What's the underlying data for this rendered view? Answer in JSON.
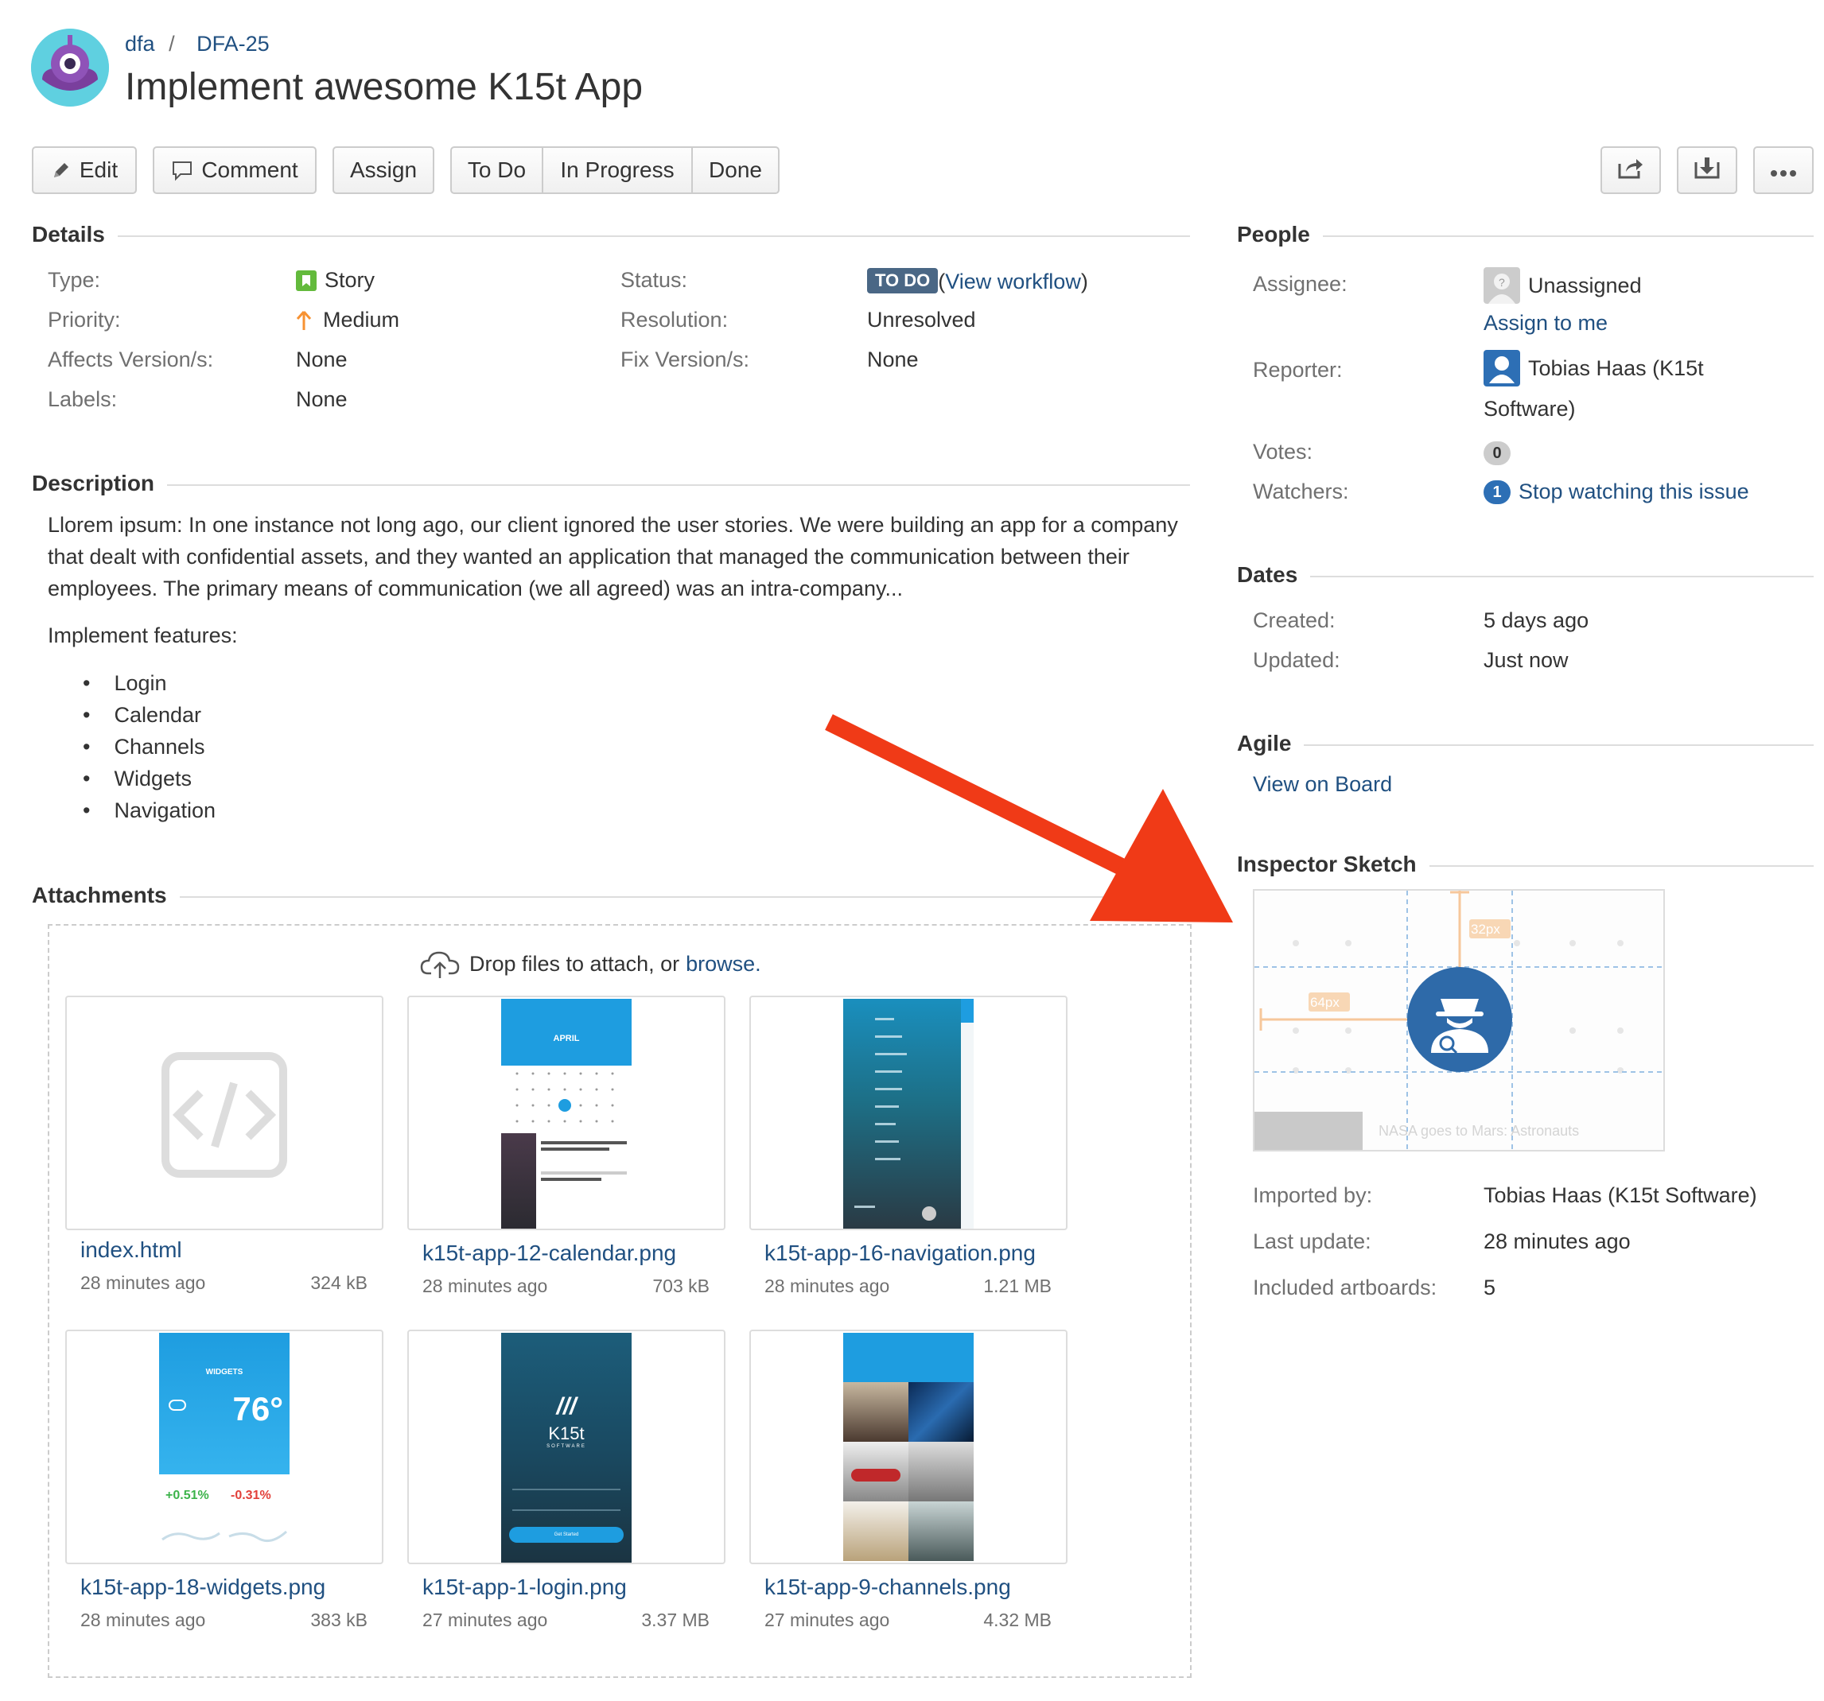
{
  "breadcrumb": {
    "project": "dfa",
    "separator": "/",
    "issue_key": "DFA-25"
  },
  "title": "Implement awesome K15t App",
  "toolbar": {
    "edit": "Edit",
    "comment": "Comment",
    "assign": "Assign",
    "todo": "To Do",
    "in_progress": "In Progress",
    "done": "Done",
    "share_icon": "share-icon",
    "export_icon": "export-icon",
    "more_icon": "more-icon"
  },
  "details": {
    "heading": "Details",
    "type_label": "Type:",
    "type_value": "Story",
    "priority_label": "Priority:",
    "priority_value": "Medium",
    "affects_label": "Affects Version/s:",
    "affects_value": "None",
    "labels_label": "Labels:",
    "labels_value": "None",
    "status_label": "Status:",
    "status_badge": "TO DO",
    "status_link": "View workflow",
    "resolution_label": "Resolution:",
    "resolution_value": "Unresolved",
    "fix_label": "Fix Version/s:",
    "fix_value": "None"
  },
  "description": {
    "heading": "Description",
    "text": "Llorem ipsum: In one instance not long ago, our client ignored the user stories. We were building an app for a company that dealt with confidential assets, and they wanted an application that managed the communication between their employees. The primary means of communication (we all agreed) was an intra-company...",
    "features_intro": "Implement features:",
    "features": [
      "Login",
      "Calendar",
      "Channels",
      "Widgets",
      "Navigation"
    ]
  },
  "attachments": {
    "heading": "Attachments",
    "drop_text": "Drop files to attach, or",
    "browse": "browse.",
    "files": [
      {
        "name": "index.html",
        "time": "28 minutes ago",
        "size": "324 kB"
      },
      {
        "name": "k15t-app-12-calendar.png",
        "time": "28 minutes ago",
        "size": "703 kB"
      },
      {
        "name": "k15t-app-16-navigation.png",
        "time": "28 minutes ago",
        "size": "1.21 MB"
      },
      {
        "name": "k15t-app-18-widgets.png",
        "time": "28 minutes ago",
        "size": "383 kB"
      },
      {
        "name": "k15t-app-1-login.png",
        "time": "27 minutes ago",
        "size": "3.37 MB"
      },
      {
        "name": "k15t-app-9-channels.png",
        "time": "27 minutes ago",
        "size": "4.32 MB"
      }
    ],
    "thumb_text": {
      "calendar_month": "APRIL",
      "widgets_title": "WIDGETS",
      "widgets_temp": "76°",
      "widgets_up": "+0.51%",
      "widgets_down": "-0.31%",
      "login_logo": "K15t",
      "login_sub": "SOFTWARE",
      "login_button": "Get Started"
    }
  },
  "people": {
    "heading": "People",
    "assignee_label": "Assignee:",
    "assignee_value": "Unassigned",
    "assign_to_me": "Assign to me",
    "reporter_label": "Reporter:",
    "reporter_value_line1": "Tobias Haas (K15t",
    "reporter_value_line2": "Software)",
    "votes_label": "Votes:",
    "votes_count": "0",
    "watchers_label": "Watchers:",
    "watchers_count": "1",
    "stop_watching": "Stop watching this issue"
  },
  "dates": {
    "heading": "Dates",
    "created_label": "Created:",
    "created_value": "5 days ago",
    "updated_label": "Updated:",
    "updated_value": "Just now"
  },
  "agile": {
    "heading": "Agile",
    "view_on_board": "View on Board"
  },
  "inspector": {
    "heading": "Inspector Sketch",
    "preview_label_1": "32px",
    "preview_label_2": "64px",
    "preview_caption": "NASA goes to Mars: Astronauts",
    "imported_label": "Imported by:",
    "imported_value": "Tobias Haas (K15t Software)",
    "last_update_label": "Last update:",
    "last_update_value": "28 minutes ago",
    "artboards_label": "Included artboards:",
    "artboards_value": "5"
  },
  "colors": {
    "link": "#205081",
    "status_todo": "#4a6785",
    "arrow": "#f03a17",
    "story": "#63ba3c",
    "priority": "#f79232"
  }
}
